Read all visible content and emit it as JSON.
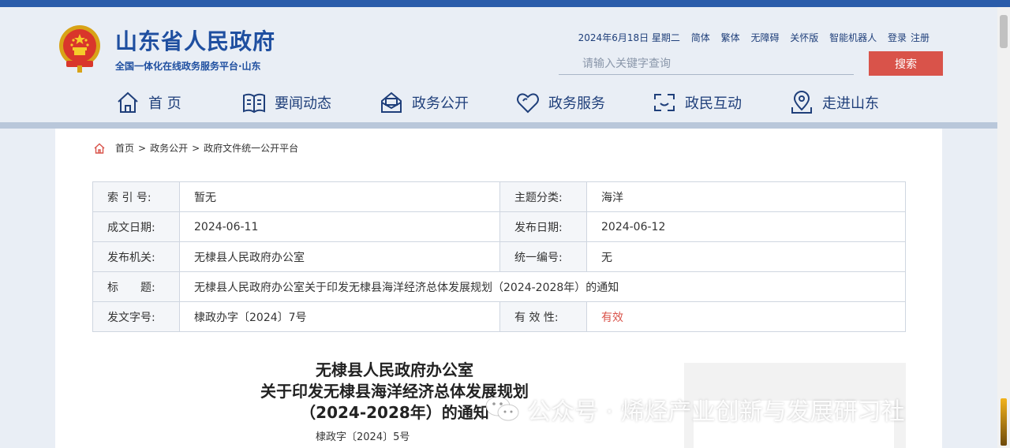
{
  "header": {
    "site_title": "山东省人民政府",
    "site_subtitle": "全国一体化在线政务服务平台·山东",
    "date": "2024年6月18日 星期二",
    "links": [
      "简体",
      "繁体",
      "无障碍",
      "关怀版",
      "智能机器人",
      "登录",
      "注册"
    ],
    "search_placeholder": "请输入关键字查询",
    "search_button": "搜索"
  },
  "nav": [
    {
      "label": "首 页",
      "icon": "home-icon"
    },
    {
      "label": "要闻动态",
      "icon": "newspaper-icon"
    },
    {
      "label": "政务公开",
      "icon": "open-box-icon"
    },
    {
      "label": "政务服务",
      "icon": "heart-icon"
    },
    {
      "label": "政民互动",
      "icon": "interaction-icon"
    },
    {
      "label": "走进山东",
      "icon": "location-icon"
    }
  ],
  "breadcrumb": {
    "items": [
      "首页",
      "政务公开",
      "政府文件统一公开平台"
    ],
    "separator": ">"
  },
  "meta": {
    "index_label": "索 引 号:",
    "index_value": "暂无",
    "topic_label": "主题分类:",
    "topic_value": "海洋",
    "created_label": "成文日期:",
    "created_value": "2024-06-11",
    "published_label": "发布日期:",
    "published_value": "2024-06-12",
    "issuer_label": "发布机关:",
    "issuer_value": "无棣县人民政府办公室",
    "unified_label": "统一编号:",
    "unified_value": "无",
    "title_label": "标　　题:",
    "title_value": "无棣县人民政府办公室关于印发无棣县海洋经济总体发展规划（2024-2028年）的通知",
    "docno_label": "发文字号:",
    "docno_value": "棣政办字〔2024〕7号",
    "validity_label": "有 效 性:",
    "validity_value": "有效"
  },
  "document": {
    "title_line1": "无棣县人民政府办公室",
    "title_line2": "关于印发无棣县海洋经济总体发展规划",
    "title_line3": "（2024-2028年）的通知",
    "doc_number": "棣政字〔2024〕5号"
  },
  "watermark": {
    "text": "公众号 · 烯烃产业创新与发展研习社"
  },
  "colors": {
    "brand_blue": "#1f4fa0",
    "accent_red": "#d9534a",
    "topbar": "#2a5caa"
  }
}
